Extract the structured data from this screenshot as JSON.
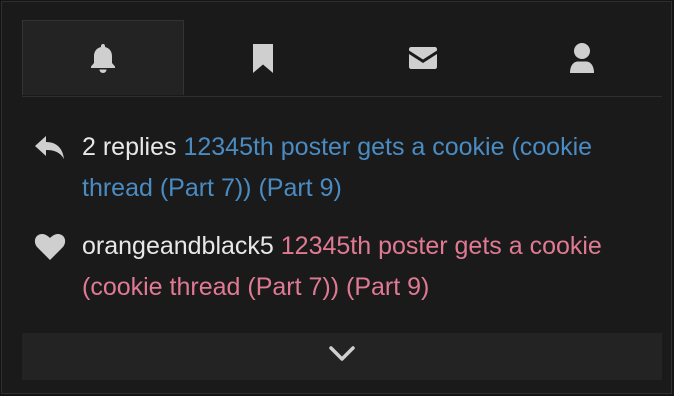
{
  "tabs": [
    {
      "icon": "bell-icon",
      "active": true
    },
    {
      "icon": "bookmark-icon",
      "active": false
    },
    {
      "icon": "envelope-icon",
      "active": false
    },
    {
      "icon": "user-icon",
      "active": false
    }
  ],
  "notifications": [
    {
      "icon": "reply-icon",
      "actor": "2 replies",
      "link": "12345th poster gets a cookie (cookie thread (Part 7)) (Part 9)",
      "link_color": "#4a8bc2"
    },
    {
      "icon": "heart-icon",
      "actor": "orangeandblack5",
      "link": "12345th poster gets a cookie (cookie thread (Part 7)) (Part 9)",
      "link_color": "#e07a93"
    }
  ],
  "expand": {
    "icon": "chevron-down-icon"
  },
  "colors": {
    "background": "#1a1a1a",
    "icon": "#cfcfcf",
    "blue_link": "#4a8bc2",
    "pink_link": "#e07a93"
  }
}
